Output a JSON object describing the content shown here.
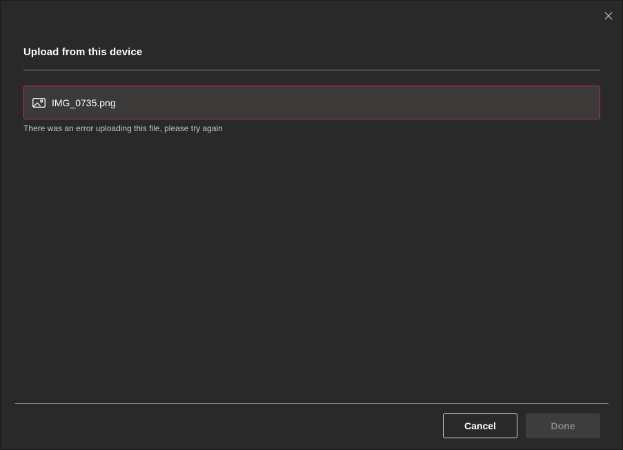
{
  "dialog": {
    "title": "Upload from this device",
    "close_icon": "close-icon"
  },
  "file": {
    "icon": "image-file-icon",
    "name": "IMG_0735.png",
    "error_message": "There was an error uploading this file, please try again"
  },
  "footer": {
    "cancel_label": "Cancel",
    "done_label": "Done"
  },
  "colors": {
    "background": "#292929",
    "file_row_background": "#3b3a39",
    "error_border": "#c4314b",
    "divider": "#8a8a8a",
    "done_disabled_background": "#3d3d3d",
    "done_disabled_text": "#8a8886"
  }
}
